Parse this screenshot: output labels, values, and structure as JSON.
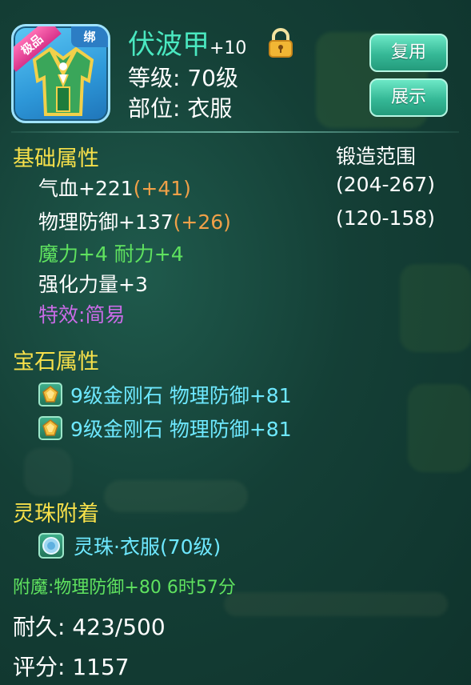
{
  "item": {
    "grade_badge": "极品",
    "bind_badge": "绑",
    "name": "伏波甲",
    "enhance": "+10",
    "level": "等级: 70级",
    "slot": "部位: 衣服",
    "locked": true
  },
  "buttons": {
    "reuse": "复用",
    "show": "展示"
  },
  "basic": {
    "title": "基础属性",
    "forge_title": "锻造范围",
    "hp": {
      "base": "气血+221",
      "bonus": "(+41)",
      "range": "(204-267)"
    },
    "defense": {
      "base": "物理防御+137",
      "bonus": "(+26)",
      "range": "(120-158)"
    },
    "extra": "魔力+4 耐力+4",
    "strength": "强化力量+3",
    "effect": "特效:简易"
  },
  "gems": {
    "title": "宝石属性",
    "items": [
      {
        "text": "9级金刚石 物理防御+81"
      },
      {
        "text": "9级金刚石 物理防御+81"
      }
    ]
  },
  "orb": {
    "title": "灵珠附着",
    "text": "灵珠·衣服(70级)"
  },
  "enchant": "附魔:物理防御+80  6时57分",
  "durability": "耐久:  423/500",
  "score": "评分: 1157",
  "colors": {
    "name": "#4ae8c0",
    "section": "#f7e04a",
    "bonus": "#f0a048",
    "green": "#5fe25f",
    "purple": "#c96be6",
    "gem": "#6ee8ff"
  }
}
